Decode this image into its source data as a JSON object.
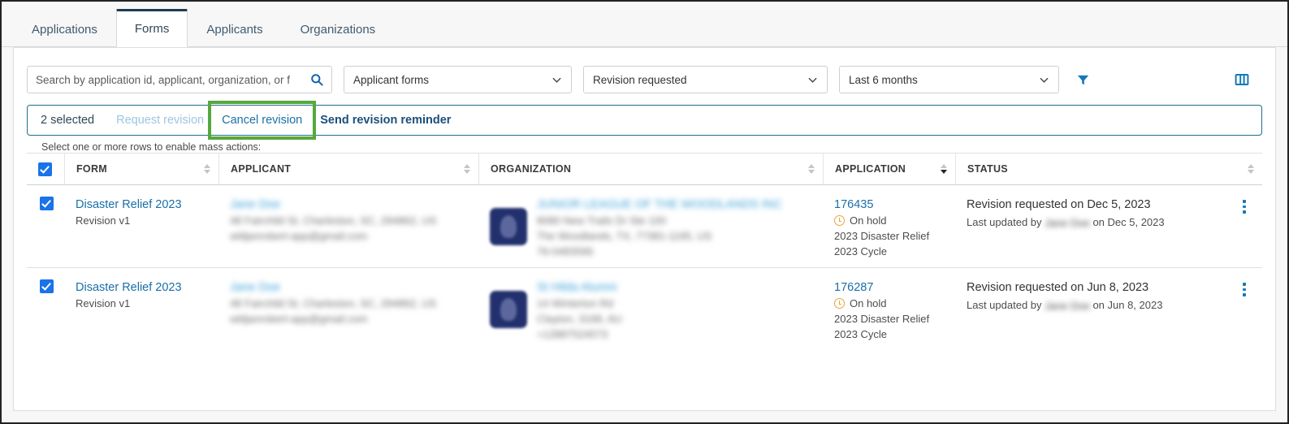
{
  "tabs": [
    {
      "label": "Applications",
      "active": false
    },
    {
      "label": "Forms",
      "active": true
    },
    {
      "label": "Applicants",
      "active": false
    },
    {
      "label": "Organizations",
      "active": false
    }
  ],
  "filters": {
    "search": {
      "value": "",
      "placeholder": "Search by application id, applicant, organization, or f"
    },
    "form_type": {
      "value": "Applicant forms"
    },
    "status": {
      "value": "Revision requested"
    },
    "date_range": {
      "value": "Last 6 months"
    },
    "filter_icon": "filter-funnel-icon",
    "columns_icon": "columns-layout-icon"
  },
  "mass_actions": {
    "count_label": "2 selected",
    "request_revision": "Request revision",
    "cancel_revision": "Cancel revision",
    "send_reminder": "Send revision reminder",
    "hint": "Select one or more rows to enable mass actions:",
    "highlight_color": "#56a83c",
    "border_color": "#1e6e8c"
  },
  "table": {
    "headers": {
      "form": "FORM",
      "applicant": "APPLICANT",
      "organization": "ORGANIZATION",
      "application": "APPLICATION",
      "status": "STATUS"
    },
    "sort": {
      "column": "application",
      "direction": "desc"
    },
    "rows": [
      {
        "selected": true,
        "form_name": "Disaster Relief 2023",
        "form_revision": "Revision v1",
        "applicant_name": "Jane Doe",
        "applicant_address": "48 Fairchild St, Charleston, SC, 294862, US",
        "applicant_email": "wldjanrobert-app@gmail.com",
        "organization_name": "JUNIOR LEAGUE OF THE WOODLANDS INC",
        "organization_address1": "8080 New Trails Dr Ste 100",
        "organization_address2": "The Woodlands, TX, 77381-1195, US",
        "organization_ein": "76-0483566",
        "application_id": "176435",
        "application_state": "On hold",
        "application_program": "2023 Disaster Relief",
        "application_cycle": "2023 Cycle",
        "status_main": "Revision requested on Dec 5, 2023",
        "status_updated_prefix": "Last updated by",
        "status_updated_by": "Jane Doe",
        "status_updated_suffix": "on Dec 5, 2023"
      },
      {
        "selected": true,
        "form_name": "Disaster Relief 2023",
        "form_revision": "Revision v1",
        "applicant_name": "Jane Doe",
        "applicant_address": "48 Fairchild St, Charleston, SC, 294862, US",
        "applicant_email": "wldjanrobert-app@gmail.com",
        "organization_name": "St Hilda Alumni",
        "organization_address1": "14 Winterton Rd",
        "organization_address2": "Clayton, 3168, AU",
        "organization_ein": "+12887524573",
        "application_id": "176287",
        "application_state": "On hold",
        "application_program": "2023 Disaster Relief",
        "application_cycle": "2023 Cycle",
        "status_main": "Revision requested on Jun 8, 2023",
        "status_updated_prefix": "Last updated by",
        "status_updated_by": "Jane Doe",
        "status_updated_suffix": "on Jun 8, 2023"
      }
    ]
  }
}
